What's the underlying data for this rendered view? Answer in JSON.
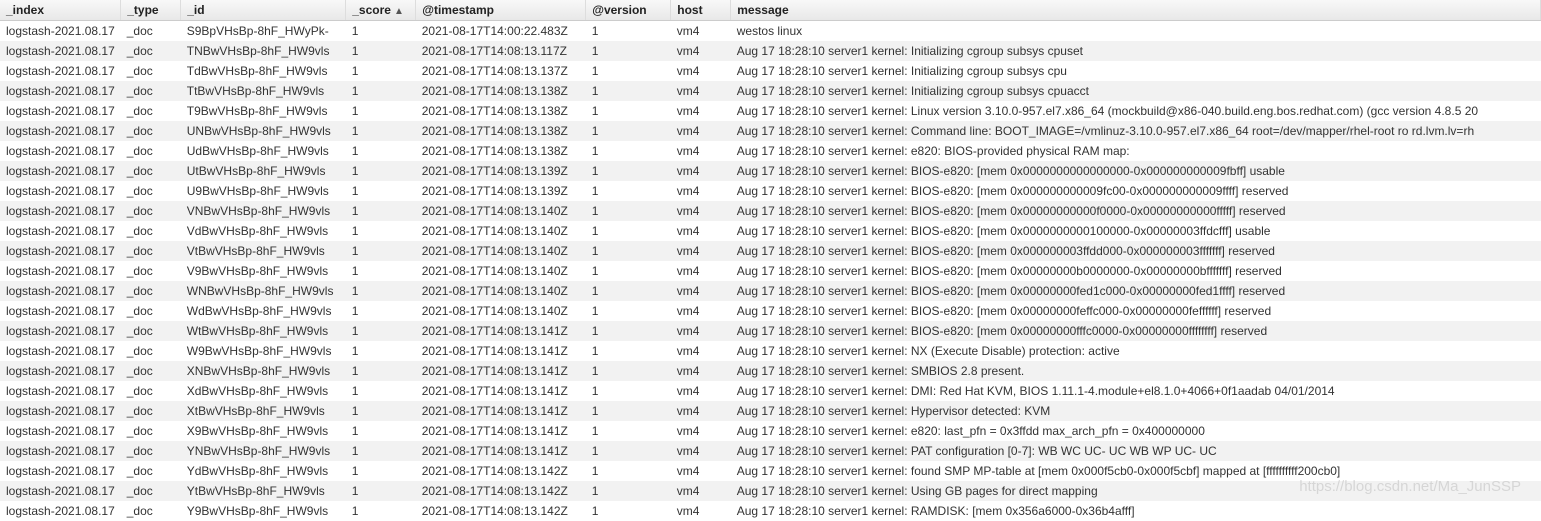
{
  "columns": [
    {
      "key": "index",
      "label": "_index",
      "sorted": false
    },
    {
      "key": "type",
      "label": "_type",
      "sorted": false
    },
    {
      "key": "id",
      "label": "_id",
      "sorted": false
    },
    {
      "key": "score",
      "label": "_score",
      "sorted": true,
      "sort_indicator": "▲"
    },
    {
      "key": "ts",
      "label": "@timestamp",
      "sorted": false
    },
    {
      "key": "version",
      "label": "@version",
      "sorted": false
    },
    {
      "key": "host",
      "label": "host",
      "sorted": false
    },
    {
      "key": "message",
      "label": "message",
      "sorted": false
    }
  ],
  "rows": [
    {
      "index": "logstash-2021.08.17",
      "type": "_doc",
      "id": "S9BpVHsBp-8hF_HWyPk-",
      "score": "1",
      "ts": "2021-08-17T14:00:22.483Z",
      "version": "1",
      "host": "vm4",
      "message": "westos linux"
    },
    {
      "index": "logstash-2021.08.17",
      "type": "_doc",
      "id": "TNBwVHsBp-8hF_HW9vls",
      "score": "1",
      "ts": "2021-08-17T14:08:13.117Z",
      "version": "1",
      "host": "vm4",
      "message": "Aug 17 18:28:10 server1 kernel: Initializing cgroup subsys cpuset"
    },
    {
      "index": "logstash-2021.08.17",
      "type": "_doc",
      "id": "TdBwVHsBp-8hF_HW9vls",
      "score": "1",
      "ts": "2021-08-17T14:08:13.137Z",
      "version": "1",
      "host": "vm4",
      "message": "Aug 17 18:28:10 server1 kernel: Initializing cgroup subsys cpu"
    },
    {
      "index": "logstash-2021.08.17",
      "type": "_doc",
      "id": "TtBwVHsBp-8hF_HW9vls",
      "score": "1",
      "ts": "2021-08-17T14:08:13.138Z",
      "version": "1",
      "host": "vm4",
      "message": "Aug 17 18:28:10 server1 kernel: Initializing cgroup subsys cpuacct"
    },
    {
      "index": "logstash-2021.08.17",
      "type": "_doc",
      "id": "T9BwVHsBp-8hF_HW9vls",
      "score": "1",
      "ts": "2021-08-17T14:08:13.138Z",
      "version": "1",
      "host": "vm4",
      "message": "Aug 17 18:28:10 server1 kernel: Linux version 3.10.0-957.el7.x86_64 (mockbuild@x86-040.build.eng.bos.redhat.com) (gcc version 4.8.5 20"
    },
    {
      "index": "logstash-2021.08.17",
      "type": "_doc",
      "id": "UNBwVHsBp-8hF_HW9vls",
      "score": "1",
      "ts": "2021-08-17T14:08:13.138Z",
      "version": "1",
      "host": "vm4",
      "message": "Aug 17 18:28:10 server1 kernel: Command line: BOOT_IMAGE=/vmlinuz-3.10.0-957.el7.x86_64 root=/dev/mapper/rhel-root ro rd.lvm.lv=rh"
    },
    {
      "index": "logstash-2021.08.17",
      "type": "_doc",
      "id": "UdBwVHsBp-8hF_HW9vls",
      "score": "1",
      "ts": "2021-08-17T14:08:13.138Z",
      "version": "1",
      "host": "vm4",
      "message": "Aug 17 18:28:10 server1 kernel: e820: BIOS-provided physical RAM map:"
    },
    {
      "index": "logstash-2021.08.17",
      "type": "_doc",
      "id": "UtBwVHsBp-8hF_HW9vls",
      "score": "1",
      "ts": "2021-08-17T14:08:13.139Z",
      "version": "1",
      "host": "vm4",
      "message": "Aug 17 18:28:10 server1 kernel: BIOS-e820: [mem 0x0000000000000000-0x000000000009fbff] usable"
    },
    {
      "index": "logstash-2021.08.17",
      "type": "_doc",
      "id": "U9BwVHsBp-8hF_HW9vls",
      "score": "1",
      "ts": "2021-08-17T14:08:13.139Z",
      "version": "1",
      "host": "vm4",
      "message": "Aug 17 18:28:10 server1 kernel: BIOS-e820: [mem 0x000000000009fc00-0x000000000009ffff] reserved"
    },
    {
      "index": "logstash-2021.08.17",
      "type": "_doc",
      "id": "VNBwVHsBp-8hF_HW9vls",
      "score": "1",
      "ts": "2021-08-17T14:08:13.140Z",
      "version": "1",
      "host": "vm4",
      "message": "Aug 17 18:28:10 server1 kernel: BIOS-e820: [mem 0x00000000000f0000-0x00000000000fffff] reserved"
    },
    {
      "index": "logstash-2021.08.17",
      "type": "_doc",
      "id": "VdBwVHsBp-8hF_HW9vls",
      "score": "1",
      "ts": "2021-08-17T14:08:13.140Z",
      "version": "1",
      "host": "vm4",
      "message": "Aug 17 18:28:10 server1 kernel: BIOS-e820: [mem 0x0000000000100000-0x00000003ffdcfff] usable"
    },
    {
      "index": "logstash-2021.08.17",
      "type": "_doc",
      "id": "VtBwVHsBp-8hF_HW9vls",
      "score": "1",
      "ts": "2021-08-17T14:08:13.140Z",
      "version": "1",
      "host": "vm4",
      "message": "Aug 17 18:28:10 server1 kernel: BIOS-e820: [mem 0x000000003ffdd000-0x000000003fffffff] reserved"
    },
    {
      "index": "logstash-2021.08.17",
      "type": "_doc",
      "id": "V9BwVHsBp-8hF_HW9vls",
      "score": "1",
      "ts": "2021-08-17T14:08:13.140Z",
      "version": "1",
      "host": "vm4",
      "message": "Aug 17 18:28:10 server1 kernel: BIOS-e820: [mem 0x00000000b0000000-0x00000000bfffffff] reserved"
    },
    {
      "index": "logstash-2021.08.17",
      "type": "_doc",
      "id": "WNBwVHsBp-8hF_HW9vls",
      "score": "1",
      "ts": "2021-08-17T14:08:13.140Z",
      "version": "1",
      "host": "vm4",
      "message": "Aug 17 18:28:10 server1 kernel: BIOS-e820: [mem 0x00000000fed1c000-0x00000000fed1ffff] reserved"
    },
    {
      "index": "logstash-2021.08.17",
      "type": "_doc",
      "id": "WdBwVHsBp-8hF_HW9vls",
      "score": "1",
      "ts": "2021-08-17T14:08:13.140Z",
      "version": "1",
      "host": "vm4",
      "message": "Aug 17 18:28:10 server1 kernel: BIOS-e820: [mem 0x00000000feffc000-0x00000000feffffff] reserved"
    },
    {
      "index": "logstash-2021.08.17",
      "type": "_doc",
      "id": "WtBwVHsBp-8hF_HW9vls",
      "score": "1",
      "ts": "2021-08-17T14:08:13.141Z",
      "version": "1",
      "host": "vm4",
      "message": "Aug 17 18:28:10 server1 kernel: BIOS-e820: [mem 0x00000000fffc0000-0x00000000ffffffff] reserved"
    },
    {
      "index": "logstash-2021.08.17",
      "type": "_doc",
      "id": "W9BwVHsBp-8hF_HW9vls",
      "score": "1",
      "ts": "2021-08-17T14:08:13.141Z",
      "version": "1",
      "host": "vm4",
      "message": "Aug 17 18:28:10 server1 kernel: NX (Execute Disable) protection: active"
    },
    {
      "index": "logstash-2021.08.17",
      "type": "_doc",
      "id": "XNBwVHsBp-8hF_HW9vls",
      "score": "1",
      "ts": "2021-08-17T14:08:13.141Z",
      "version": "1",
      "host": "vm4",
      "message": "Aug 17 18:28:10 server1 kernel: SMBIOS 2.8 present."
    },
    {
      "index": "logstash-2021.08.17",
      "type": "_doc",
      "id": "XdBwVHsBp-8hF_HW9vls",
      "score": "1",
      "ts": "2021-08-17T14:08:13.141Z",
      "version": "1",
      "host": "vm4",
      "message": "Aug 17 18:28:10 server1 kernel: DMI: Red Hat KVM, BIOS 1.11.1-4.module+el8.1.0+4066+0f1aadab 04/01/2014"
    },
    {
      "index": "logstash-2021.08.17",
      "type": "_doc",
      "id": "XtBwVHsBp-8hF_HW9vls",
      "score": "1",
      "ts": "2021-08-17T14:08:13.141Z",
      "version": "1",
      "host": "vm4",
      "message": "Aug 17 18:28:10 server1 kernel: Hypervisor detected: KVM"
    },
    {
      "index": "logstash-2021.08.17",
      "type": "_doc",
      "id": "X9BwVHsBp-8hF_HW9vls",
      "score": "1",
      "ts": "2021-08-17T14:08:13.141Z",
      "version": "1",
      "host": "vm4",
      "message": "Aug 17 18:28:10 server1 kernel: e820: last_pfn = 0x3ffdd max_arch_pfn = 0x400000000"
    },
    {
      "index": "logstash-2021.08.17",
      "type": "_doc",
      "id": "YNBwVHsBp-8hF_HW9vls",
      "score": "1",
      "ts": "2021-08-17T14:08:13.141Z",
      "version": "1",
      "host": "vm4",
      "message": "Aug 17 18:28:10 server1 kernel: PAT configuration [0-7]: WB WC UC- UC WB WP UC- UC"
    },
    {
      "index": "logstash-2021.08.17",
      "type": "_doc",
      "id": "YdBwVHsBp-8hF_HW9vls",
      "score": "1",
      "ts": "2021-08-17T14:08:13.142Z",
      "version": "1",
      "host": "vm4",
      "message": "Aug 17 18:28:10 server1 kernel: found SMP MP-table at [mem 0x000f5cb0-0x000f5cbf] mapped at [ffffffffff200cb0]"
    },
    {
      "index": "logstash-2021.08.17",
      "type": "_doc",
      "id": "YtBwVHsBp-8hF_HW9vls",
      "score": "1",
      "ts": "2021-08-17T14:08:13.142Z",
      "version": "1",
      "host": "vm4",
      "message": "Aug 17 18:28:10 server1 kernel: Using GB pages for direct mapping"
    },
    {
      "index": "logstash-2021.08.17",
      "type": "_doc",
      "id": "Y9BwVHsBp-8hF_HW9vls",
      "score": "1",
      "ts": "2021-08-17T14:08:13.142Z",
      "version": "1",
      "host": "vm4",
      "message": "Aug 17 18:28:10 server1 kernel: RAMDISK: [mem 0x356a6000-0x36b4afff]"
    }
  ],
  "watermark": "https://blog.csdn.net/Ma_JunSSP"
}
